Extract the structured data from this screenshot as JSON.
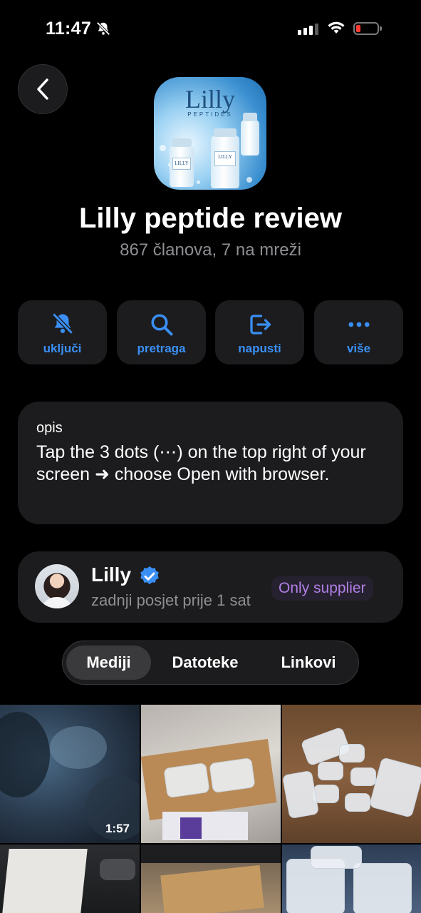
{
  "status_bar": {
    "time": "11:47"
  },
  "group": {
    "avatar_logo": "Lilly",
    "avatar_subtitle": "PEPTIDES",
    "name": "Lilly peptide review",
    "members": "867 članova, 7 na mreži"
  },
  "actions": [
    {
      "label": "uključi",
      "icon": "bell-slash-icon"
    },
    {
      "label": "pretraga",
      "icon": "search-icon"
    },
    {
      "label": "napusti",
      "icon": "leave-icon"
    },
    {
      "label": "više",
      "icon": "more-icon"
    }
  ],
  "description": {
    "label": "opis",
    "text": "Tap the 3 dots (⋯) on the top right of your screen ➜ choose Open with browser."
  },
  "admin": {
    "name": "Lilly",
    "last_seen": "zadnji posjet prije 1 sat",
    "badge": "Only supplier"
  },
  "tabs": [
    "Mediji",
    "Datoteke",
    "Linkovi"
  ],
  "active_tab": "Mediji",
  "media": [
    {
      "duration": "1:57"
    }
  ],
  "colors": {
    "accent": "#3a8ff5",
    "badge": "#b07fe6",
    "card": "#1c1c1e"
  }
}
